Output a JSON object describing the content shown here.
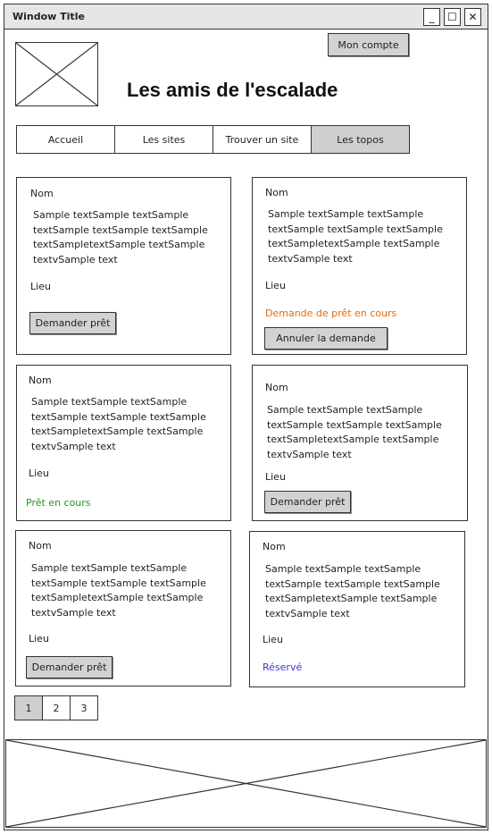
{
  "window": {
    "title": "Window Title",
    "minimize_label": "_",
    "maximize_label": "☐",
    "close_label": "✕"
  },
  "header": {
    "account_button": "Mon compte",
    "site_title": "Les amis de l'escalade"
  },
  "nav": {
    "items": [
      "Accueil",
      "Les sites",
      "Trouver un site",
      "Les topos"
    ],
    "active_index": 3
  },
  "colors": {
    "pending": "#e86a00",
    "loaned": "#1f9a1f",
    "reserved": "#3a3ad8"
  },
  "cards": [
    {
      "name": "Nom",
      "text": "Sample textSample textSample textSample textSample textSample textSampletextSample textSample textvSample text",
      "lieu": "Lieu",
      "status_text": "",
      "button": "Demander prêt"
    },
    {
      "name": "Nom",
      "text": "Sample textSample textSample textSample textSample textSample textSampletextSample textSample textvSample text",
      "lieu": "Lieu",
      "status_text": "Demande de prêt en cours",
      "button": "Annuler la demande"
    },
    {
      "name": "Nom",
      "text": "Sample textSample textSample textSample textSample textSample textSampletextSample textSample textvSample text",
      "lieu": "Lieu",
      "status_text": "Prêt en cours",
      "button": ""
    },
    {
      "name": "Nom",
      "text": "Sample textSample textSample textSample textSample textSample textSampletextSample textSample textvSample text",
      "lieu": "Lieu",
      "status_text": "",
      "button": "Demander prêt"
    },
    {
      "name": "Nom",
      "text": "Sample textSample textSample textSample textSample textSample textSampletextSample textSample textvSample text",
      "lieu": "Lieu",
      "status_text": "",
      "button": "Demander prêt"
    },
    {
      "name": "Nom",
      "text": "Sample textSample textSample textSample textSample textSample textSampletextSample textSample textvSample text",
      "lieu": "Lieu",
      "status_text": "Réservé",
      "button": ""
    }
  ],
  "pagination": {
    "pages": [
      "1",
      "2",
      "3"
    ],
    "active_index": 0
  }
}
